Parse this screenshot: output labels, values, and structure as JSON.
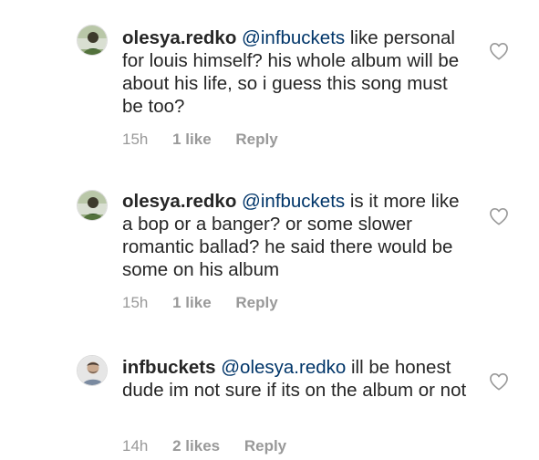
{
  "colors": {
    "text": "#262626",
    "mention": "#003569",
    "meta": "#999999",
    "heart_outline": "#999999"
  },
  "comments": [
    {
      "username": "olesya.redko",
      "mention": "@infbuckets",
      "text": " like personal for louis himself? his whole album will be about his life, so i guess this song must be too?",
      "time": "15h",
      "likes": "1 like",
      "reply": "Reply",
      "avatar_icon": "avatar-photo-olesya",
      "like_icon": "heart-outline-icon"
    },
    {
      "username": "olesya.redko",
      "mention": "@infbuckets",
      "text": " is it more like a bop or a banger? or some slower romantic ballad? he said there would be some on his album",
      "time": "15h",
      "likes": "1 like",
      "reply": "Reply",
      "avatar_icon": "avatar-photo-olesya",
      "like_icon": "heart-outline-icon"
    },
    {
      "username": "infbuckets",
      "mention": "@olesya.redko",
      "text": " ill be honest dude im not sure if its on the album or not",
      "time": "14h",
      "likes": "2 likes",
      "reply": "Reply",
      "avatar_icon": "avatar-photo-infbuckets",
      "like_icon": "heart-outline-icon"
    }
  ]
}
